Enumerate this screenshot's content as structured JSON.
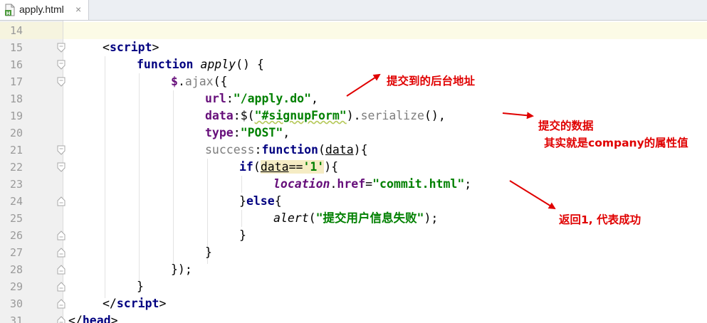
{
  "tab": {
    "label": "apply.html",
    "close_glyph": "×",
    "icon": "html-file-icon",
    "icon_letter": "H"
  },
  "line_numbers": [
    "14",
    "15",
    "16",
    "17",
    "18",
    "19",
    "20",
    "21",
    "22",
    "23",
    "24",
    "25",
    "26",
    "27",
    "28",
    "29",
    "30",
    "31"
  ],
  "code": {
    "l15": {
      "open": "<",
      "tag": "script",
      "close": ">"
    },
    "l16": {
      "kw": "function",
      "sp": " ",
      "name": "apply",
      "rest": "() {"
    },
    "l17": {
      "dollar": "$",
      "dot": ".",
      "ajax": "ajax",
      "rest": "({"
    },
    "l18": {
      "key": "url",
      "colon": ":",
      "str": "\"/apply.do\"",
      "comma": ","
    },
    "l19": {
      "key": "data",
      "colon": ":",
      "dollar": "$(",
      "str": "\"#signupForm\"",
      "close": ").",
      "method": "serialize",
      "rest": "(),"
    },
    "l20": {
      "key": "type",
      "colon": ":",
      "str": "\"POST\"",
      "comma": ","
    },
    "l21": {
      "key": "success",
      "colon": ":",
      "kw": "function",
      "open": "(",
      "param": "data",
      "rest": "){"
    },
    "l22": {
      "kw": "if",
      "open": "(",
      "var": "data",
      "op": "==",
      "str": "'1'",
      "rest": "){"
    },
    "l23": {
      "loc": "location",
      "dot": ".",
      "href": "href",
      "eq": "=",
      "str": "\"commit.html\"",
      "semi": ";"
    },
    "l24": {
      "brace": "}",
      "kw": "else",
      "rest": "{"
    },
    "l25": {
      "fn": "alert",
      "open": "(",
      "str": "\"提交用户信息失败\"",
      "rest": ");"
    },
    "l26": {
      "text": "}"
    },
    "l27": {
      "text": "}"
    },
    "l28": {
      "text": "});"
    },
    "l29": {
      "text": "}"
    },
    "l30": {
      "open": "</",
      "tag": "script",
      "close": ">"
    },
    "l31": {
      "open": "</",
      "tag": "head",
      "close": ">"
    }
  },
  "annotations": {
    "a1": "提交到的后台地址",
    "a2": "提交的数据",
    "a3": "其实就是company的属性值",
    "a4": "返回1, 代表成功"
  },
  "colors": {
    "annotation": "#e00000",
    "keyword": "#000080",
    "string": "#008000",
    "identifier": "#660e7a"
  }
}
